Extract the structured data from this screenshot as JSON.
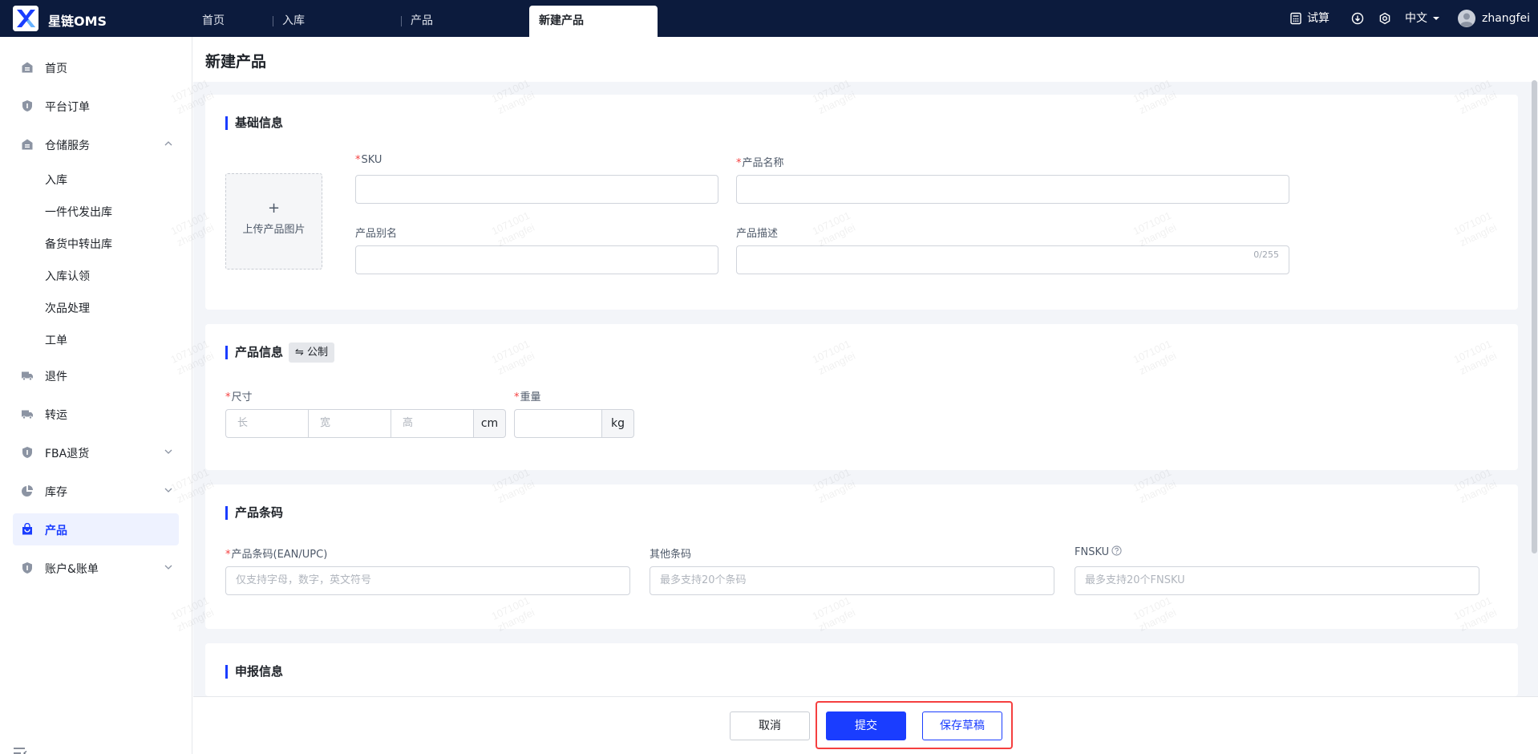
{
  "app": {
    "name": "星链OMS"
  },
  "tabs": [
    {
      "label": "首页"
    },
    {
      "label": "入库"
    },
    {
      "label": "产品"
    },
    {
      "label": "新建产品"
    }
  ],
  "topright": {
    "calc": "试算",
    "lang": "中文",
    "user": "zhangfei"
  },
  "sidebar": {
    "items": [
      {
        "label": "首页",
        "icon": "home-icon"
      },
      {
        "label": "平台订单",
        "icon": "shield-icon"
      },
      {
        "label": "仓储服务",
        "icon": "warehouse-icon"
      },
      {
        "label": "退件",
        "icon": "truck-icon"
      },
      {
        "label": "转运",
        "icon": "truck-icon"
      },
      {
        "label": "FBA退货",
        "icon": "shield-icon"
      },
      {
        "label": "库存",
        "icon": "pie-chart-icon"
      },
      {
        "label": "产品",
        "icon": "bag-icon"
      },
      {
        "label": "账户&账单",
        "icon": "shield-icon"
      }
    ],
    "sub": [
      "入库",
      "一件代发出库",
      "备货中转出库",
      "入库认领",
      "次品处理",
      "工单"
    ]
  },
  "page": {
    "title": "新建产品"
  },
  "basic": {
    "title": "基础信息",
    "upload_label": "上传产品图片",
    "upload_plus": "+",
    "required_mark": "*",
    "sku_label": "SKU",
    "name_label": "产品名称",
    "alias_label": "产品别名",
    "desc_label": "产品描述",
    "desc_counter": "0/255"
  },
  "product_info": {
    "title": "产品信息",
    "unit_toggle": "⇋ 公制",
    "size_label": "尺寸",
    "length_ph": "长",
    "width_ph": "宽",
    "height_ph": "高",
    "size_unit": "cm",
    "weight_label": "重量",
    "weight_unit": "kg"
  },
  "barcode": {
    "title": "产品条码",
    "ean_label": "产品条码(EAN/UPC)",
    "ean_ph": "仅支持字母，数字，英文符号",
    "other_label": "其他条码",
    "other_ph": "最多支持20个条码",
    "fnsku_label": "FNSKU",
    "fnsku_ph": "最多支持20个FNSKU"
  },
  "declare": {
    "title": "申报信息"
  },
  "footer": {
    "cancel": "取消",
    "submit": "提交",
    "draft": "保存草稿"
  },
  "watermark": {
    "line1": "1071001",
    "line2": "zhangfei"
  },
  "colors": {
    "topbar": "#0c1b3d",
    "primary": "#1a3dff",
    "required": "#f53f3f",
    "highlight": "#f53f3f"
  }
}
